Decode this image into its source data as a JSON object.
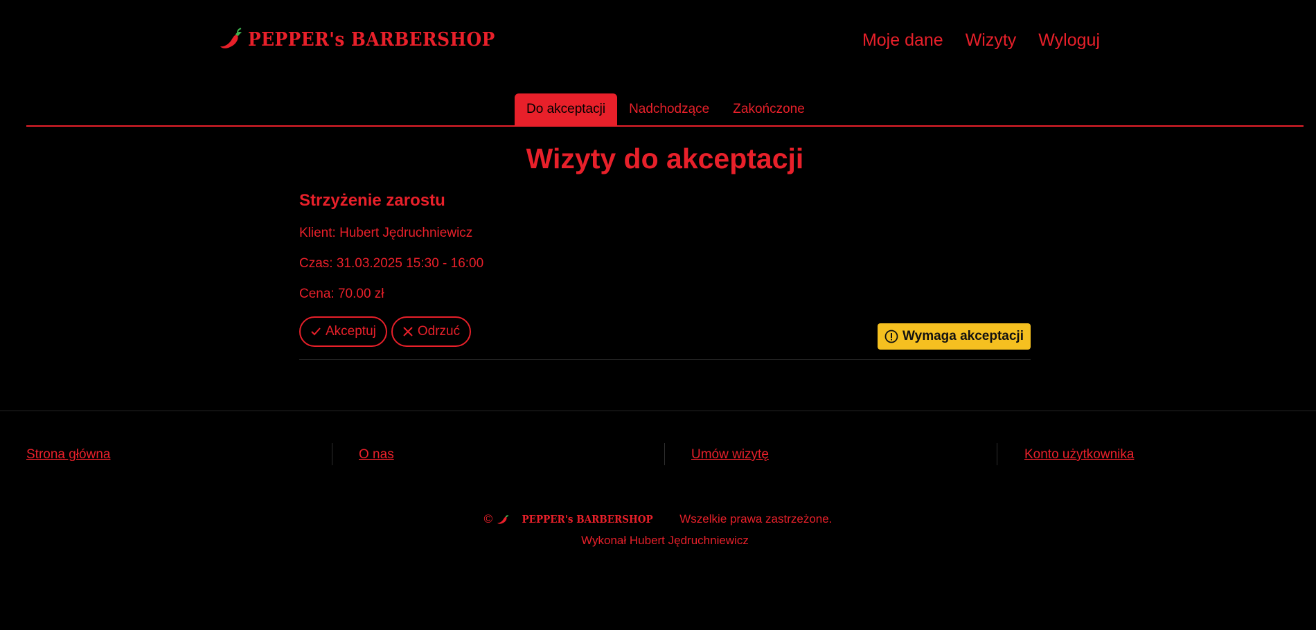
{
  "brand": {
    "name": "PEPPER's BARBERSHOP",
    "color": "#e8202a"
  },
  "nav": {
    "items": [
      "Moje dane",
      "Wizyty",
      "Wyloguj"
    ]
  },
  "tabs": {
    "items": [
      "Do akceptacji",
      "Nadchodzące",
      "Zakończone"
    ],
    "active": "Do akceptacji"
  },
  "page": {
    "title": "Wizyty do akceptacji"
  },
  "visit": {
    "service": "Strzyżenie zarostu",
    "client": "Klient: Hubert Jędruchniewicz",
    "time": "Czas: 31.03.2025 15:30 - 16:00",
    "price": "Cena: 70.00 zł",
    "accept_label": "Akceptuj",
    "reject_label": "Odrzuć",
    "status": "Wymaga akceptacji",
    "status_color": "#f5c020"
  },
  "footer": {
    "links": [
      "Strona główna",
      "O nas",
      "Umów wizytę",
      "Konto użytkownika"
    ],
    "copyright_symbol": "©",
    "rights": "Wszelkie prawa zastrzeżone.",
    "credit": "Wykonał Hubert Jędruchniewicz"
  },
  "icons": {
    "logo": "chili-pepper-icon",
    "accept": "check-icon",
    "reject": "close-icon",
    "status": "exclamation-circle-icon"
  }
}
